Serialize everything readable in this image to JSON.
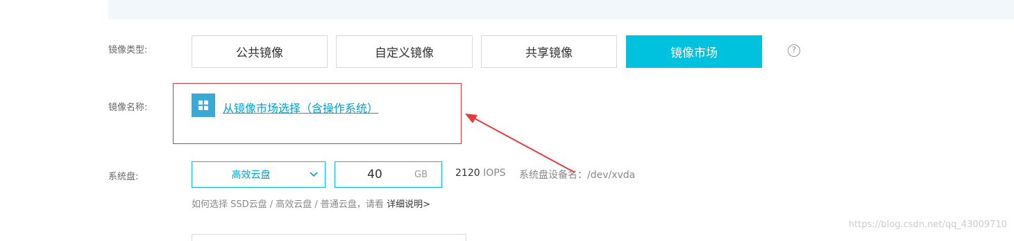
{
  "image_type": {
    "label": "镜像类型:",
    "tabs": [
      {
        "label": "公共镜像",
        "active": false
      },
      {
        "label": "自定义镜像",
        "active": false
      },
      {
        "label": "共享镜像",
        "active": false
      },
      {
        "label": "镜像市场",
        "active": true
      }
    ],
    "help_glyph": "?"
  },
  "image_name": {
    "label": "镜像名称:",
    "market_icon": "grid-icon",
    "link_text": "从镜像市场选择（含操作系统）"
  },
  "system_disk": {
    "label": "系统盘:",
    "type_selected": "高效云盘",
    "size_value": "40",
    "size_unit": "GB",
    "iops_value": "2120",
    "iops_label": "IOPS",
    "device_label": "系统盘设备名：/dev/xvda",
    "hint_text": "如何选择 SSD云盘 / 高效云盘 / 普通云盘，请看 ",
    "hint_link": "详细说明>"
  },
  "watermark": "https://blog.csdn.net/qq_43009710",
  "colors": {
    "accent": "#00c1de",
    "link": "#00a2ca",
    "highlight_border": "#d9363e",
    "arrow": "#e8383d"
  }
}
